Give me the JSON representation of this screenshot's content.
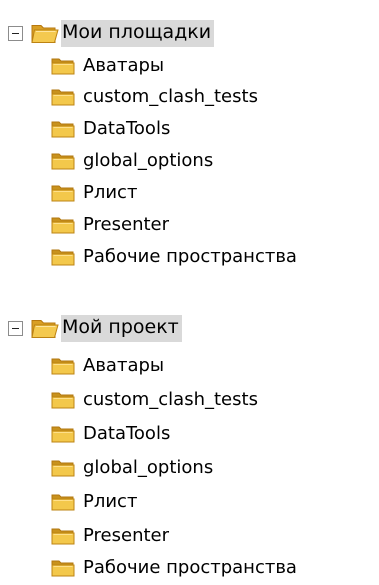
{
  "tree": {
    "roots": [
      {
        "label": "Мои площадки",
        "expander_icon": "minus-box-icon",
        "folder_icon": "open-folder-icon",
        "selected": true,
        "children": [
          {
            "label": "Аватары",
            "icon": "folder-icon"
          },
          {
            "label": "custom_clash_tests",
            "icon": "folder-icon"
          },
          {
            "label": "DataTools",
            "icon": "folder-icon"
          },
          {
            "label": "global_options",
            "icon": "folder-icon"
          },
          {
            "label": "Рлист",
            "icon": "folder-icon"
          },
          {
            "label": "Presenter",
            "icon": "folder-icon"
          },
          {
            "label": "Рабочие пространства",
            "icon": "folder-icon"
          }
        ]
      },
      {
        "label": "Мой проект",
        "expander_icon": "minus-box-icon",
        "folder_icon": "open-folder-icon",
        "selected": true,
        "children": [
          {
            "label": "Аватары",
            "icon": "folder-icon"
          },
          {
            "label": "custom_clash_tests",
            "icon": "folder-icon"
          },
          {
            "label": "DataTools",
            "icon": "folder-icon"
          },
          {
            "label": "global_options",
            "icon": "folder-icon"
          },
          {
            "label": "Рлист",
            "icon": "folder-icon"
          },
          {
            "label": "Presenter",
            "icon": "folder-icon"
          },
          {
            "label": "Рабочие пространства",
            "icon": "folder-icon"
          }
        ]
      }
    ]
  },
  "colors": {
    "folder_fill": "#f3c84b",
    "folder_dark": "#c58a12",
    "folder_light": "#ffe18a",
    "selection": "#d9d9d9"
  }
}
